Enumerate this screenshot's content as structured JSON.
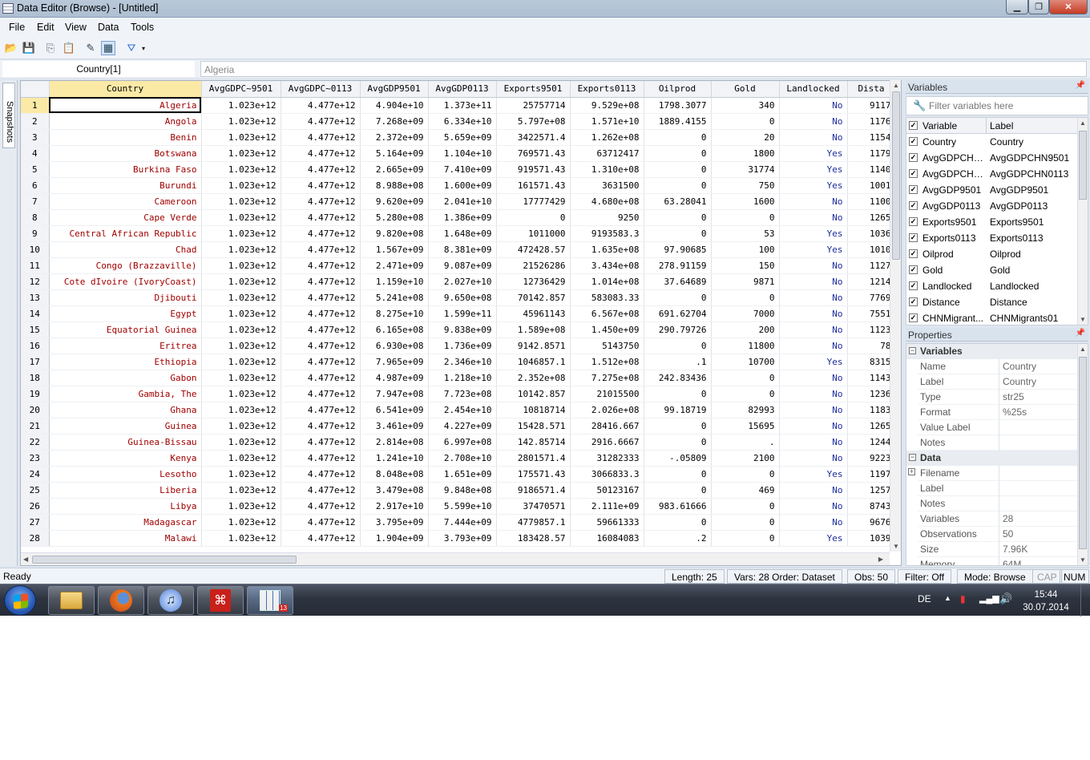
{
  "window": {
    "title": "Data Editor (Browse) - [Untitled]"
  },
  "menu": [
    "File",
    "Edit",
    "View",
    "Data",
    "Tools"
  ],
  "varname_box": "Country[1]",
  "value_box": "Algeria",
  "snapshots_tab": "Snapshots",
  "grid": {
    "columns": [
      "Country",
      "AvgGDPC~9501",
      "AvgGDPC~0113",
      "AvgGDP9501",
      "AvgGDP0113",
      "Exports9501",
      "Exports0113",
      "Oilprod",
      "Gold",
      "Landlocked",
      "Dista"
    ],
    "rows": [
      [
        "1",
        "Algeria",
        "1.023e+12",
        "4.477e+12",
        "4.904e+10",
        "1.373e+11",
        "25757714",
        "9.529e+08",
        "1798.3077",
        "340",
        "No",
        "9117"
      ],
      [
        "2",
        "Angola",
        "1.023e+12",
        "4.477e+12",
        "7.268e+09",
        "6.334e+10",
        "5.797e+08",
        "1.571e+10",
        "1889.4155",
        "0",
        "No",
        "1176"
      ],
      [
        "3",
        "Benin",
        "1.023e+12",
        "4.477e+12",
        "2.372e+09",
        "5.659e+09",
        "3422571.4",
        "1.262e+08",
        "0",
        "20",
        "No",
        "1154"
      ],
      [
        "4",
        "Botswana",
        "1.023e+12",
        "4.477e+12",
        "5.164e+09",
        "1.104e+10",
        "769571.43",
        "63712417",
        "0",
        "1800",
        "Yes",
        "1179"
      ],
      [
        "5",
        "Burkina Faso",
        "1.023e+12",
        "4.477e+12",
        "2.665e+09",
        "7.410e+09",
        "919571.43",
        "1.310e+08",
        "0",
        "31774",
        "Yes",
        "1140"
      ],
      [
        "6",
        "Burundi",
        "1.023e+12",
        "4.477e+12",
        "8.988e+08",
        "1.600e+09",
        "161571.43",
        "3631500",
        "0",
        "750",
        "Yes",
        "1001"
      ],
      [
        "7",
        "Cameroon",
        "1.023e+12",
        "4.477e+12",
        "9.620e+09",
        "2.041e+10",
        "17777429",
        "4.680e+08",
        "63.28041",
        "1600",
        "No",
        "1100"
      ],
      [
        "8",
        "Cape Verde",
        "1.023e+12",
        "4.477e+12",
        "5.280e+08",
        "1.386e+09",
        "0",
        "9250",
        "0",
        "0",
        "No",
        "1265"
      ],
      [
        "9",
        "Central African Republic",
        "1.023e+12",
        "4.477e+12",
        "9.820e+08",
        "1.648e+09",
        "1011000",
        "9193583.3",
        "0",
        "53",
        "Yes",
        "1036"
      ],
      [
        "10",
        "Chad",
        "1.023e+12",
        "4.477e+12",
        "1.567e+09",
        "8.381e+09",
        "472428.57",
        "1.635e+08",
        "97.90685",
        "100",
        "Yes",
        "1010"
      ],
      [
        "11",
        "Congo (Brazzaville)",
        "1.023e+12",
        "4.477e+12",
        "2.471e+09",
        "9.087e+09",
        "21526286",
        "3.434e+08",
        "278.91159",
        "150",
        "No",
        "1127"
      ],
      [
        "12",
        "Cote dIvoire (IvoryCoast)",
        "1.023e+12",
        "4.477e+12",
        "1.159e+10",
        "2.027e+10",
        "12736429",
        "1.014e+08",
        "37.64689",
        "9871",
        "No",
        "1214"
      ],
      [
        "13",
        "Djibouti",
        "1.023e+12",
        "4.477e+12",
        "5.241e+08",
        "9.650e+08",
        "70142.857",
        "583083.33",
        "0",
        "0",
        "No",
        "7769"
      ],
      [
        "14",
        "Egypt",
        "1.023e+12",
        "4.477e+12",
        "8.275e+10",
        "1.599e+11",
        "45961143",
        "6.567e+08",
        "691.62704",
        "7000",
        "No",
        "7551"
      ],
      [
        "15",
        "Equatorial Guinea",
        "1.023e+12",
        "4.477e+12",
        "6.165e+08",
        "9.838e+09",
        "1.589e+08",
        "1.450e+09",
        "290.79726",
        "200",
        "No",
        "1123"
      ],
      [
        "16",
        "Eritrea",
        "1.023e+12",
        "4.477e+12",
        "6.930e+08",
        "1.736e+09",
        "9142.8571",
        "5143750",
        "0",
        "11800",
        "No",
        "78"
      ],
      [
        "17",
        "Ethiopia",
        "1.023e+12",
        "4.477e+12",
        "7.965e+09",
        "2.346e+10",
        "1046857.1",
        "1.512e+08",
        ".1",
        "10700",
        "Yes",
        "8315"
      ],
      [
        "18",
        "Gabon",
        "1.023e+12",
        "4.477e+12",
        "4.987e+09",
        "1.218e+10",
        "2.352e+08",
        "7.275e+08",
        "242.83436",
        "0",
        "No",
        "1143"
      ],
      [
        "19",
        "Gambia, The",
        "1.023e+12",
        "4.477e+12",
        "7.947e+08",
        "7.723e+08",
        "10142.857",
        "21015500",
        "0",
        "0",
        "No",
        "1236"
      ],
      [
        "20",
        "Ghana",
        "1.023e+12",
        "4.477e+12",
        "6.541e+09",
        "2.454e+10",
        "10818714",
        "2.026e+08",
        "99.18719",
        "82993",
        "No",
        "1183"
      ],
      [
        "21",
        "Guinea",
        "1.023e+12",
        "4.477e+12",
        "3.461e+09",
        "4.227e+09",
        "15428.571",
        "28416.667",
        "0",
        "15695",
        "No",
        "1265"
      ],
      [
        "22",
        "Guinea-Bissau",
        "1.023e+12",
        "4.477e+12",
        "2.814e+08",
        "6.997e+08",
        "142.85714",
        "2916.6667",
        "0",
        ".",
        "No",
        "1244"
      ],
      [
        "23",
        "Kenya",
        "1.023e+12",
        "4.477e+12",
        "1.241e+10",
        "2.708e+10",
        "2801571.4",
        "31282333",
        "-.05809",
        "2100",
        "No",
        "9223"
      ],
      [
        "24",
        "Lesotho",
        "1.023e+12",
        "4.477e+12",
        "8.048e+08",
        "1.651e+09",
        "175571.43",
        "3066833.3",
        "0",
        "0",
        "Yes",
        "1197"
      ],
      [
        "25",
        "Liberia",
        "1.023e+12",
        "4.477e+12",
        "3.479e+08",
        "9.848e+08",
        "9186571.4",
        "50123167",
        "0",
        "469",
        "No",
        "1257"
      ],
      [
        "26",
        "Libya",
        "1.023e+12",
        "4.477e+12",
        "2.917e+10",
        "5.599e+10",
        "37470571",
        "2.111e+09",
        "983.61666",
        "0",
        "No",
        "8743"
      ],
      [
        "27",
        "Madagascar",
        "1.023e+12",
        "4.477e+12",
        "3.795e+09",
        "7.444e+09",
        "4779857.1",
        "59661333",
        "0",
        "0",
        "No",
        "9676"
      ],
      [
        "28",
        "Malawi",
        "1.023e+12",
        "4.477e+12",
        "1.904e+09",
        "3.793e+09",
        "183428.57",
        "16084083",
        ".2",
        "0",
        "Yes",
        "1039"
      ]
    ]
  },
  "variables_panel": {
    "title": "Variables",
    "filter_placeholder": "Filter variables here",
    "headers": [
      "Variable",
      "Label"
    ],
    "rows": [
      [
        "Country",
        "Country"
      ],
      [
        "AvgGDPCHN...",
        "AvgGDPCHN9501"
      ],
      [
        "AvgGDPCHN...",
        "AvgGDPCHN0113"
      ],
      [
        "AvgGDP9501",
        "AvgGDP9501"
      ],
      [
        "AvgGDP0113",
        "AvgGDP0113"
      ],
      [
        "Exports9501",
        "Exports9501"
      ],
      [
        "Exports0113",
        "Exports0113"
      ],
      [
        "Oilprod",
        "Oilprod"
      ],
      [
        "Gold",
        "Gold"
      ],
      [
        "Landlocked",
        "Landlocked"
      ],
      [
        "Distance",
        "Distance"
      ],
      [
        "CHNMigrant...",
        "CHNMigrants01"
      ]
    ]
  },
  "properties_panel": {
    "title": "Properties",
    "variables_group": "Variables",
    "variables_rows": [
      [
        "Name",
        "Country"
      ],
      [
        "Label",
        "Country"
      ],
      [
        "Type",
        "str25"
      ],
      [
        "Format",
        "%25s"
      ],
      [
        "Value Label",
        ""
      ],
      [
        "Notes",
        ""
      ]
    ],
    "data_group": "Data",
    "data_rows": [
      [
        "Filename",
        ""
      ],
      [
        "Label",
        ""
      ],
      [
        "Notes",
        ""
      ],
      [
        "Variables",
        "28"
      ],
      [
        "Observations",
        "50"
      ],
      [
        "Size",
        "7.96K"
      ],
      [
        "Memory",
        "64M"
      ]
    ]
  },
  "status": {
    "ready": "Ready",
    "length": "Length: 25",
    "vars_order": "Vars: 28  Order: Dataset",
    "obs": "Obs: 50",
    "filter": "Filter: Off",
    "mode": "Mode: Browse",
    "cap": "CAP",
    "num": "NUM"
  },
  "taskbar": {
    "language": "DE",
    "time": "15:44",
    "date": "30.07.2014",
    "stata_badge": "13"
  },
  "colors": {
    "string_text": "#a00000",
    "label_text": "#1b2b9b",
    "selected_header": "#fbe9a6"
  }
}
